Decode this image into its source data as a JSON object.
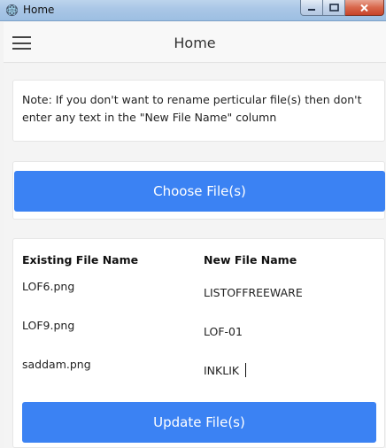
{
  "window": {
    "title": "Home"
  },
  "header": {
    "title": "Home"
  },
  "note": {
    "text": "Note: If you don't want to rename perticular file(s) then don't enter any text in the \"New File Name\" column"
  },
  "choose": {
    "label": "Choose File(s)"
  },
  "table": {
    "headers": {
      "existing": "Existing File Name",
      "new": "New File Name"
    },
    "rows": [
      {
        "existing": "LOF6.png",
        "new": "LISTOFFREEWARE"
      },
      {
        "existing": "LOF9.png",
        "new": "LOF-01"
      },
      {
        "existing": "saddam.png",
        "new": "INKLIK"
      }
    ]
  },
  "update": {
    "label": "Update File(s)"
  },
  "colors": {
    "primary": "#3b82f3",
    "title_bar": "#a9c6e6",
    "close_button": "#c7442a"
  },
  "icons": {
    "app": "electron-atom-icon",
    "menu": "hamburger-menu-icon"
  }
}
